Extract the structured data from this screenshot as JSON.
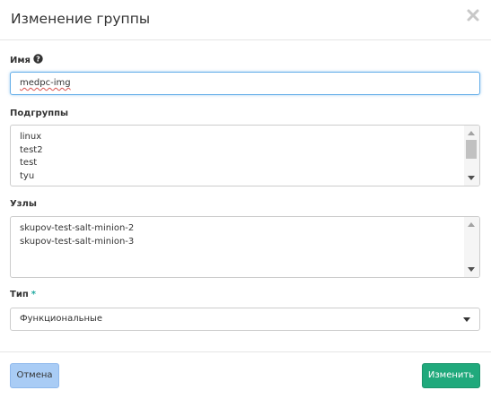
{
  "dialog": {
    "title": "Изменение группы",
    "close_icon": "close-icon"
  },
  "fields": {
    "name": {
      "label": "Имя",
      "help_icon": "question-circle-icon",
      "value": "medpc-img"
    },
    "subgroups": {
      "label": "Подгруппы",
      "items": [
        "linux",
        "test2",
        "test",
        "tyu"
      ]
    },
    "nodes": {
      "label": "Узлы",
      "items": [
        "skupov-test-salt-minion-2",
        "skupov-test-salt-minion-3"
      ]
    },
    "type": {
      "label": "Тип",
      "required_mark": "*",
      "selected": "Функциональные"
    }
  },
  "footer": {
    "cancel_label": "Отмена",
    "save_label": "Изменить"
  },
  "colors": {
    "accent": "#20a97c",
    "required": "#20a9a0",
    "focus_border": "#66afe9",
    "cancel_bg": "#a9ccf5"
  }
}
